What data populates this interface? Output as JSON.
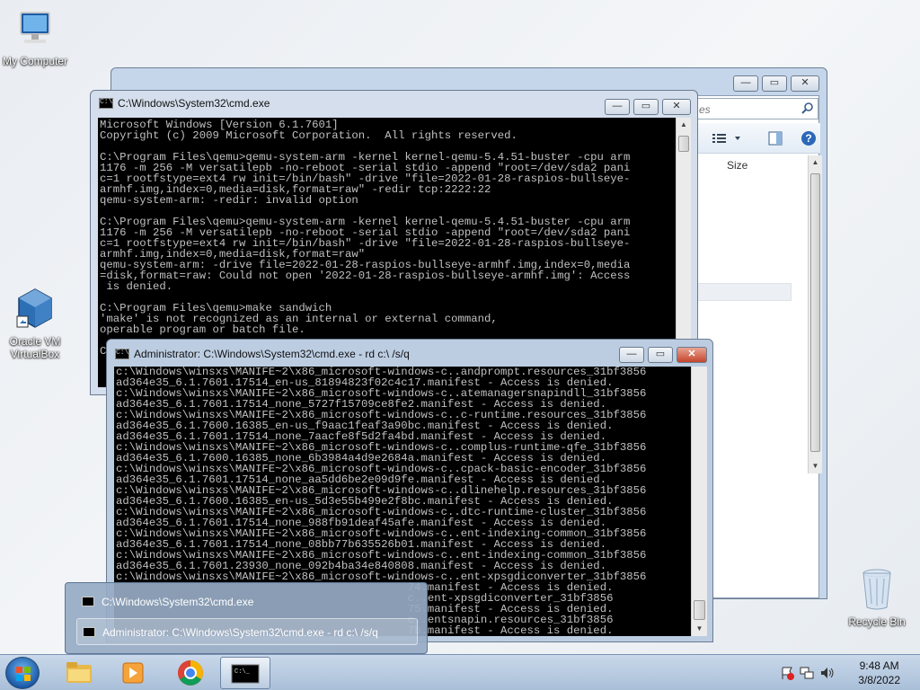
{
  "desktop": {
    "icons": [
      {
        "label": "My Computer",
        "icon": "computer-icon"
      },
      {
        "label": "Oracle VM VirtualBox",
        "icon": "virtualbox-icon"
      },
      {
        "label": "Recycle Bin",
        "icon": "recycle-bin-icon"
      }
    ]
  },
  "explorer": {
    "search_placeholder": "es",
    "column_size": "Size"
  },
  "cmd1": {
    "title": "C:\\Windows\\System32\\cmd.exe",
    "lines": [
      "Microsoft Windows [Version 6.1.7601]",
      "Copyright (c) 2009 Microsoft Corporation.  All rights reserved.",
      "",
      "C:\\Program Files\\qemu>qemu-system-arm -kernel kernel-qemu-5.4.51-buster -cpu arm",
      "1176 -m 256 -M versatilepb -no-reboot -serial stdio -append \"root=/dev/sda2 pani",
      "c=1 rootfstype=ext4 rw init=/bin/bash\" -drive \"file=2022-01-28-raspios-bullseye-",
      "armhf.img,index=0,media=disk,format=raw\" -redir tcp:2222:22",
      "qemu-system-arm: -redir: invalid option",
      "",
      "C:\\Program Files\\qemu>qemu-system-arm -kernel kernel-qemu-5.4.51-buster -cpu arm",
      "1176 -m 256 -M versatilepb -no-reboot -serial stdio -append \"root=/dev/sda2 pani",
      "c=1 rootfstype=ext4 rw init=/bin/bash\" -drive \"file=2022-01-28-raspios-bullseye-",
      "armhf.img,index=0,media=disk,format=raw\"",
      "qemu-system-arm: -drive file=2022-01-28-raspios-bullseye-armhf.img,index=0,media",
      "=disk,format=raw: Could not open '2022-01-28-raspios-bullseye-armhf.img': Access",
      " is denied.",
      "",
      "C:\\Program Files\\qemu>make sandwich",
      "'make' is not recognized as an internal or external command,",
      "operable program or batch file.",
      "",
      "C"
    ]
  },
  "cmd2": {
    "title": "Administrator: C:\\Windows\\System32\\cmd.exe - rd  c:\\ /s/q",
    "lines": [
      "c:\\Windows\\winsxs\\MANIFE~2\\x86_microsoft-windows-c..andprompt.resources_31bf3856",
      "ad364e35_6.1.7601.17514_en-us_81894823f02c4c17.manifest - Access is denied.",
      "c:\\Windows\\winsxs\\MANIFE~2\\x86_microsoft-windows-c..atemanagersnapindll_31bf3856",
      "ad364e35_6.1.7601.17514_none_5727f15709ce8fe2.manifest - Access is denied.",
      "c:\\Windows\\winsxs\\MANIFE~2\\x86_microsoft-windows-c..c-runtime.resources_31bf3856",
      "ad364e35_6.1.7600.16385_en-us_f9aac1feaf3a90bc.manifest - Access is denied.",
      "ad364e35_6.1.7601.17514_none_7aacfe8f5d2fa4bd.manifest - Access is denied.",
      "c:\\Windows\\winsxs\\MANIFE~2\\x86_microsoft-windows-c..complus-runtime-qfe_31bf3856",
      "ad364e35_6.1.7600.16385_none_6b3984a4d9e2684a.manifest - Access is denied.",
      "c:\\Windows\\winsxs\\MANIFE~2\\x86_microsoft-windows-c..cpack-basic-encoder_31bf3856",
      "ad364e35_6.1.7601.17514_none_aa5dd6be2e09d9fe.manifest - Access is denied.",
      "c:\\Windows\\winsxs\\MANIFE~2\\x86_microsoft-windows-c..dlinehelp.resources_31bf3856",
      "ad364e35_6.1.7600.16385_en-us_5d3e55b499e2f8bc.manifest - Access is denied.",
      "c:\\Windows\\winsxs\\MANIFE~2\\x86_microsoft-windows-c..dtc-runtime-cluster_31bf3856",
      "ad364e35_6.1.7601.17514_none_988fb91deaf45afe.manifest - Access is denied.",
      "c:\\Windows\\winsxs\\MANIFE~2\\x86_microsoft-windows-c..ent-indexing-common_31bf3856",
      "ad364e35_6.1.7601.17514_none_08bb77b635526b01.manifest - Access is denied.",
      "c:\\Windows\\winsxs\\MANIFE~2\\x86_microsoft-windows-c..ent-indexing-common_31bf3856",
      "ad364e35_6.1.7601.23930_none_092b4ba34e840808.manifest - Access is denied.",
      "c:\\Windows\\winsxs\\MANIFE~2\\x86_microsoft-windows-c..ent-xpsgdiconverter_31bf3856",
      "                                            74.manifest - Access is denied.",
      "                                            c..ent-xpsgdiconverter_31bf3856",
      "                                            75.manifest - Access is denied.",
      "                                            c..entsnapin.resources_31bf3856",
      "                                            7b.manifest - Access is denied."
    ]
  },
  "thumbnail_popup": {
    "items": [
      "C:\\Windows\\System32\\cmd.exe",
      "Administrator: C:\\Windows\\System32\\cmd.exe - rd  c:\\ /s/q"
    ]
  },
  "taskbar": {
    "apps": [
      "file-explorer-icon",
      "media-player-icon",
      "chrome-icon",
      "cmd-icon"
    ],
    "time": "9:48 AM",
    "date": "3/8/2022"
  },
  "window_buttons": {
    "minimize": "—",
    "maximize": "▭",
    "close": "✕"
  }
}
